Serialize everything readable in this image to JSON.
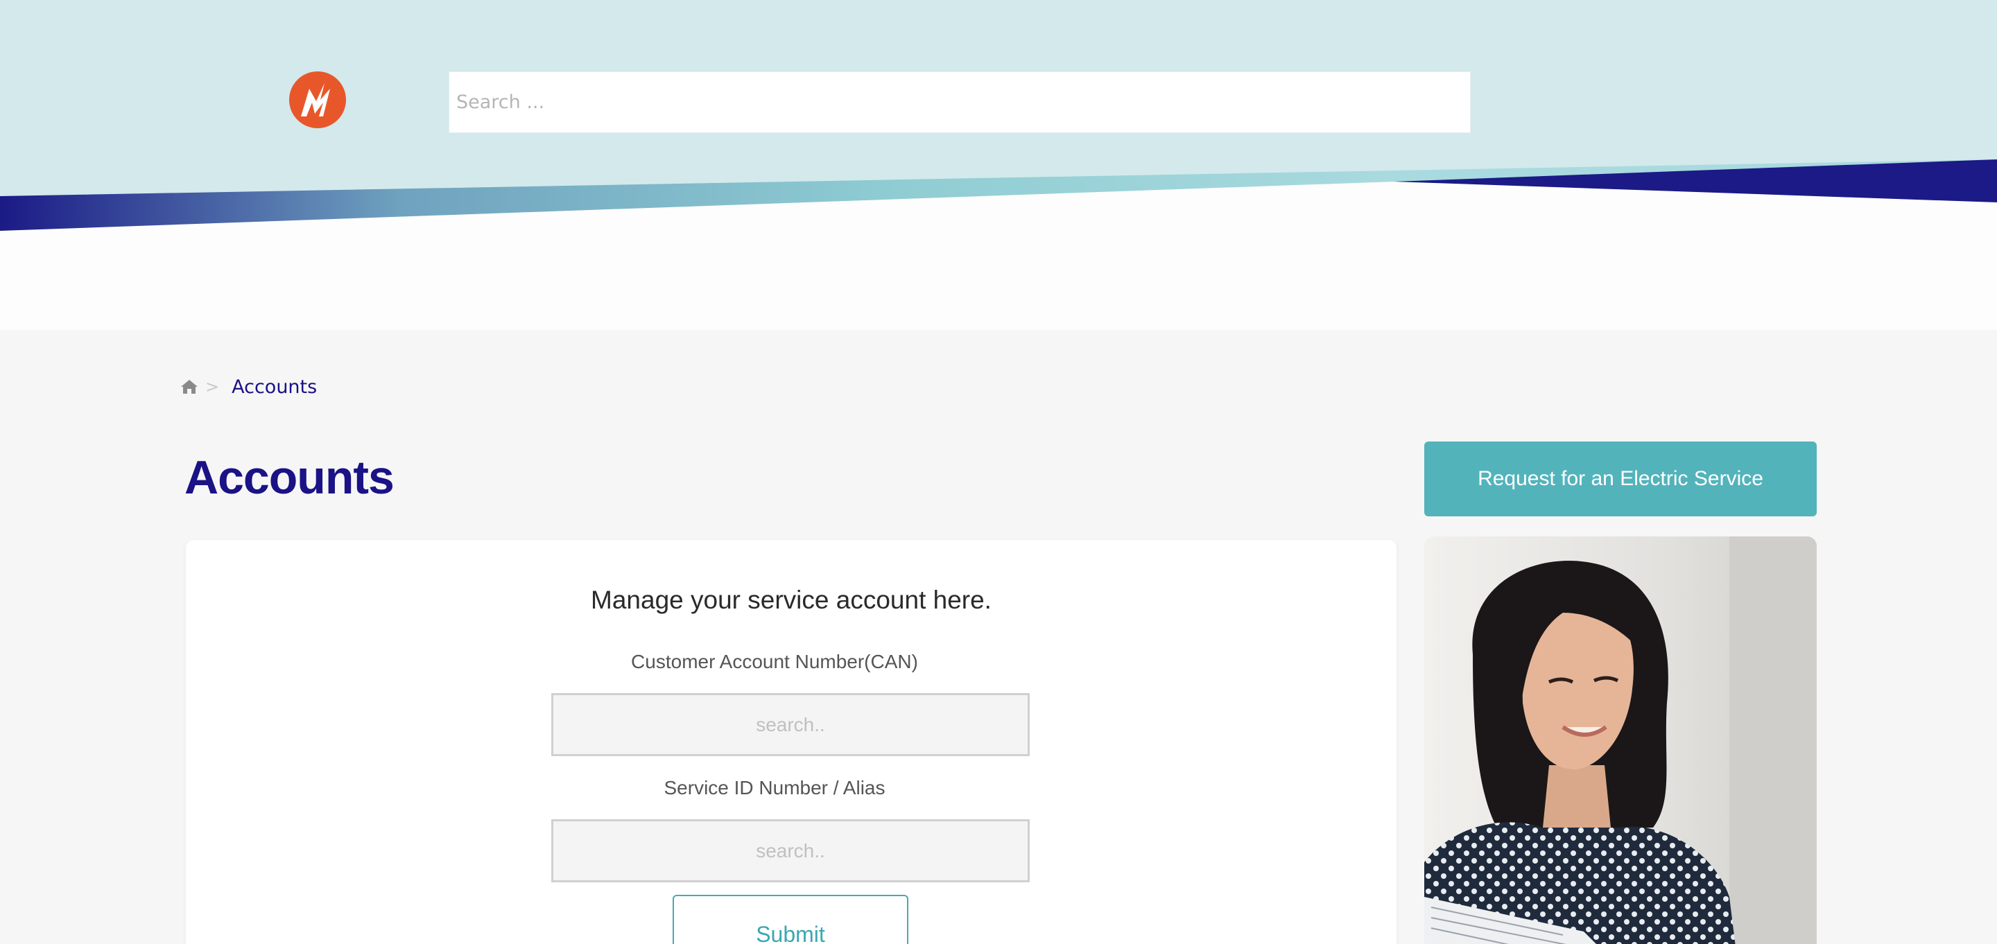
{
  "header": {
    "logo_alt": "utility logo",
    "search": {
      "placeholder": "Search ...",
      "value": ""
    }
  },
  "breadcrumb": {
    "home_icon": "home-icon",
    "separator": ">",
    "current": "Accounts"
  },
  "page": {
    "title": "Accounts"
  },
  "account_form": {
    "heading": "Manage your service account here.",
    "can_label": "Customer Account Number(CAN)",
    "can_placeholder": "search..",
    "service_label": "Service ID Number / Alias",
    "service_placeholder": "search..",
    "submit_label": "Submit"
  },
  "sidebar": {
    "cta_label": "Request for an Electric Service"
  },
  "colors": {
    "header_bg": "#d3e9eb",
    "brand_navy": "#1a1285",
    "accent_teal": "#53b3bb",
    "logo_orange": "#e8572a"
  }
}
